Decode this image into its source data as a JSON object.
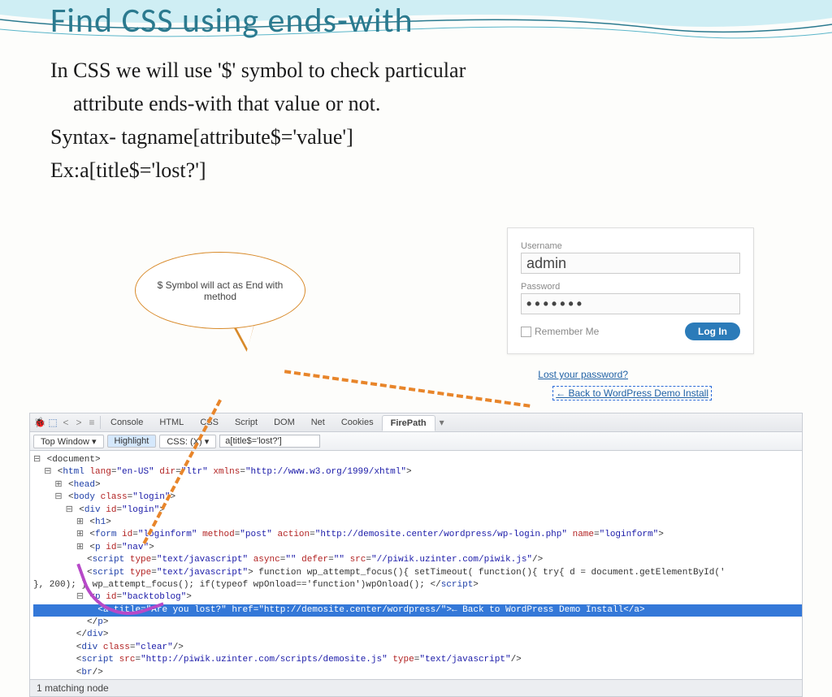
{
  "slide": {
    "title": "Find CSS using ends-with",
    "line1a": "In CSS we will use '$' symbol to check particular",
    "line1b": "attribute ends-with  that value or not.",
    "line2": "Syntax- tagname[attribute$='value']",
    "line3": "Ex:a[title$='lost?']"
  },
  "callout": {
    "text": "$ Symbol will act as End with method"
  },
  "login": {
    "username_label": "Username",
    "username_value": "admin",
    "password_label": "Password",
    "password_value": "•••••••",
    "remember": "Remember Me",
    "login_btn": "Log In",
    "lost_link": "Lost your password?",
    "back_link": "← Back to WordPress Demo Install"
  },
  "devtools": {
    "tabs": {
      "console": "Console",
      "html": "HTML",
      "css": "CSS",
      "script": "Script",
      "dom": "DOM",
      "net": "Net",
      "cookies": "Cookies",
      "firepath": "FirePath"
    },
    "subbar": {
      "topwindow": "Top Window ▾",
      "highlight": "Highlight",
      "csslabel": "CSS: (X) ▾",
      "input": "a[title$='lost?']"
    },
    "status": "1 matching node",
    "dom": {
      "l0": "⊟ <document>",
      "l1": "  ⊟ <html lang=\"en-US\" dir=\"ltr\" xmlns=\"http://www.w3.org/1999/xhtml\">",
      "l2": "    ⊞ <head>",
      "l3": "    ⊟ <body class=\"login\">",
      "l4": "      ⊟ <div id=\"login\">",
      "l5": "        ⊞ <h1>",
      "l6": "        ⊞ <form id=\"loginform\" method=\"post\" action=\"http://demosite.center/wordpress/wp-login.php\" name=\"loginform\">",
      "l7": "        ⊞ <p id=\"nav\">",
      "l8": "          <script type=\"text/javascript\" async=\"\" defer=\"\" src=\"//piwik.uzinter.com/piwik.js\"/>",
      "l9": "          <script type=\"text/javascript\"> function wp_attempt_focus(){ setTimeout( function(){ try{ d = document.getElementById('",
      "l9b": "}, 200); } wp_attempt_focus(); if(typeof wpOnload=='function')wpOnload(); </script>",
      "l10": "        ⊟ <p id=\"backtoblog\">",
      "l11": "            <a title=\"Are you lost?\" href=\"http://demosite.center/wordpress/\">← Back to WordPress Demo Install</a>",
      "l12": "          </p>",
      "l13": "        </div>",
      "l14": "        <div class=\"clear\"/>",
      "l15": "        <script src=\"http://piwik.uzinter.com/scripts/demosite.js\" type=\"text/javascript\"/>",
      "l16": "        <br/>"
    }
  }
}
